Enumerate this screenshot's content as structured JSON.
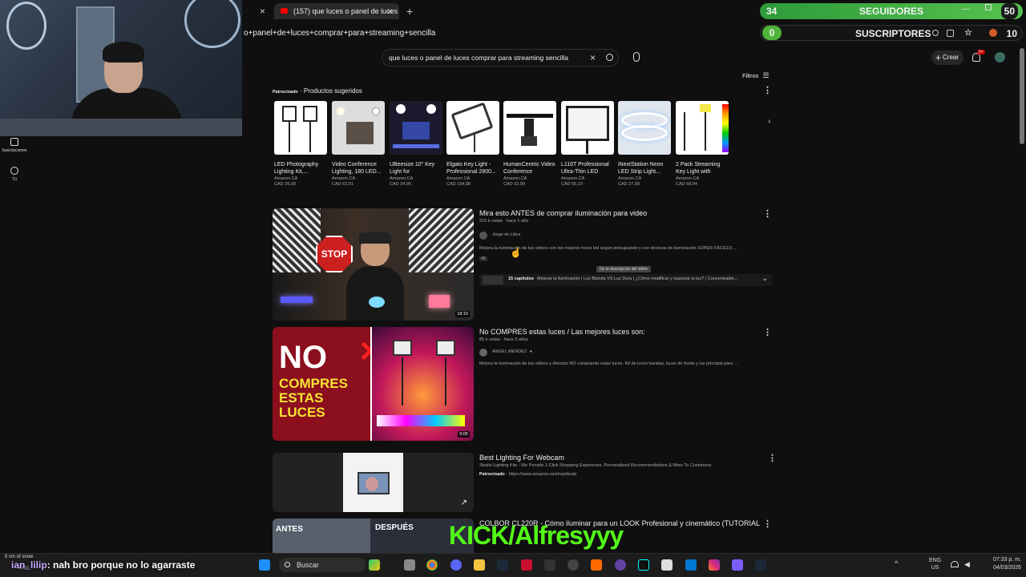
{
  "browser": {
    "tab_title": "(157) que luces o panel de luces",
    "new_tab": "+",
    "close_glyph": "×",
    "address": "o+panel+de+luces+comprar+para+streaming+sencilla"
  },
  "overlay": {
    "followers_count": "34",
    "followers_label": "SEGUIDORES",
    "followers_right": "50",
    "subs_count": "0",
    "subs_label": "SUSCRIPTORES",
    "subs_right": "10",
    "kick_text": "KICK/Alfresyyy",
    "chat_user": "ian_lilip",
    "chat_message": ": nah bro porque no lo agarraste",
    "weather": "5 cm of snow",
    "weather_sub": "Soon"
  },
  "left_rail": {
    "item1": "Suscripciones",
    "item2": "Tú"
  },
  "youtube": {
    "search_query": "que luces o panel de luces comprar para streaming sencilla",
    "create_label": "Crear",
    "notif_badge": "9+",
    "filters_label": "Filtros",
    "sponsored_label": "Patrocinado",
    "sponsored_title": "· Productos sugeridos"
  },
  "products": [
    {
      "title": "LED Photography Lighting Kit,...",
      "store": "Amazon.CA",
      "price": "CAD 39,99"
    },
    {
      "title": "Video Conference Lighting, 180 LED...",
      "store": "Amazon.CA",
      "price": "CAD 62,91"
    },
    {
      "title": "UBeesize 10\" Key Light for Streaming,...",
      "store": "Amazon.CA",
      "price": "CAD 34,95"
    },
    {
      "title": "Elgato Key Light - Professional 2800...",
      "store": "Amazon.CA",
      "price": "CAD 194,98"
    },
    {
      "title": "HumanCentric Video Conference Lighting...",
      "store": "Amazon.CA",
      "price": "CAD 32,99"
    },
    {
      "title": "L116T Professional Ultra-Thin LED Vide...",
      "store": "Amazon.CA",
      "price": "CAD 56,19"
    },
    {
      "title": "iNextStation Neon LED Strip Light...",
      "store": "Amazon.CA",
      "price": "CAD 27,99"
    },
    {
      "title": "2 Pack Streaming Key Light with Desk...",
      "store": "Amazon.CA",
      "price": "CAD 68,04"
    }
  ],
  "videos": [
    {
      "title": "Mira esto ANTES de comprar iluminación para video",
      "meta": "215 k vistas · hace 1 año",
      "channel": "Jorge de Libra",
      "desc": "Mejora la iluminación de tus videos con los mejores focos led según presupuesto y con técnicas de iluminación SÚPER FÁCILES ...",
      "badge": "4K",
      "tooltip": "De la descripción del video",
      "chapters_count": "15 capítulos",
      "chapters_text": "Mejorar la iluminación | Luz Blanda VS Luz Dura | ¿Cómo modificar y suavizar la luz? | Concentrador...",
      "duration": "18:15",
      "thumb_text": "STOP"
    },
    {
      "title": "No COMPRES estas luces / Las mejores luces son:",
      "meta": "85 k vistas · hace 3 años",
      "channel": "ANGEL MENDEZ",
      "desc": "Mejora la iluminación de tus videos y directos NO comprando estas luces. Kit de luces baratas, luces de fondo y luz principal para ...",
      "duration": "9:05",
      "thumb_l1": "NO",
      "thumb_l2": "COMPRES",
      "thumb_l3": "ESTAS",
      "thumb_l4": "LUCES"
    },
    {
      "title": "Best Lighting For Webcam",
      "desc": "Studio Lighting Kits - We Provide 1-Click Shopping Experience, Personalized Recommendations & More To Customers.",
      "sponsored": "Patrocinado",
      "url": "· https://www.amazon.ca/shop/deals"
    },
    {
      "title": "COLBOR CL220R - Cómo iluminar para un LOOK Profesional y cinemático (TUTORIAL",
      "thumb_before": "ANTES",
      "thumb_after": "DESPUÉS"
    }
  ],
  "taskbar": {
    "search_label": "Buscar",
    "lang1": "ENG",
    "lang2": "US",
    "time": "07:33 p. m.",
    "date": "04/03/2026"
  }
}
